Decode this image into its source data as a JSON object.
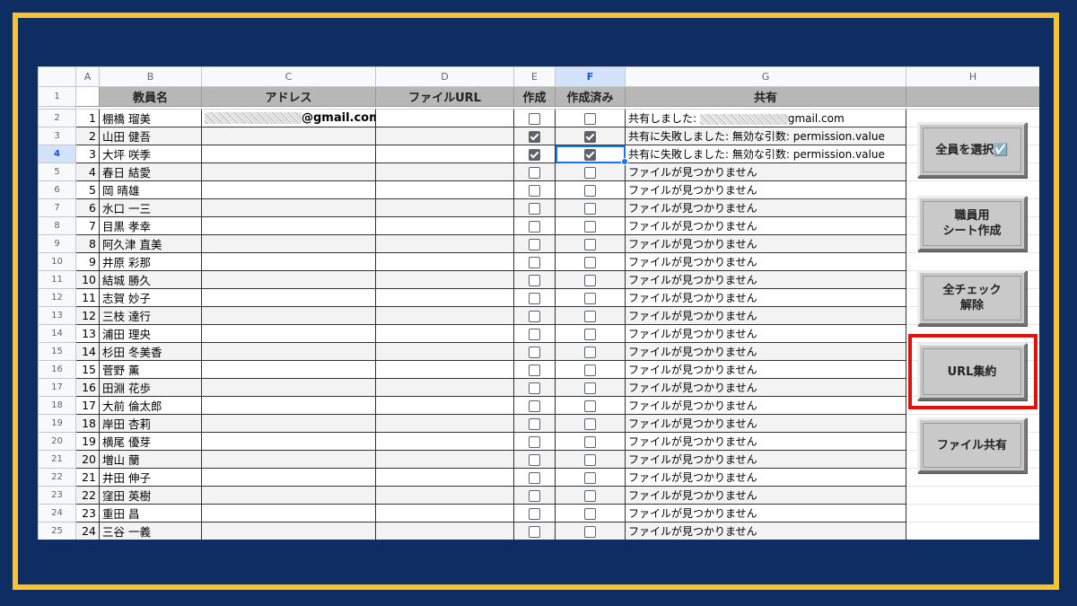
{
  "columns": [
    "",
    "A",
    "B",
    "C",
    "D",
    "E",
    "F",
    "G",
    "H"
  ],
  "selected_column": "F",
  "selected_row": "4",
  "header_row": {
    "row_num": "1",
    "name": "教員名",
    "address": "アドレス",
    "file_url": "ファイルURL",
    "created": "作成",
    "created_done": "作成済み",
    "share": "共有"
  },
  "rows": [
    {
      "rn": "2",
      "num": "1",
      "name": "棚橋 瑠美",
      "address": "@gmail.com",
      "url": "",
      "created": false,
      "done": false,
      "share": "共有しました: ",
      "share_email": "gmail.com"
    },
    {
      "rn": "3",
      "num": "2",
      "name": "山田 健吾",
      "address": "",
      "url": "",
      "created": true,
      "done": true,
      "share": "共有に失敗しました: 無効な引数: permission.value"
    },
    {
      "rn": "4",
      "num": "3",
      "name": "大坪 咲季",
      "address": "",
      "url": "",
      "created": true,
      "done": true,
      "share": "共有に失敗しました: 無効な引数: permission.value"
    },
    {
      "rn": "5",
      "num": "4",
      "name": "春日 結愛",
      "address": "",
      "url": "",
      "created": false,
      "done": false,
      "share": "ファイルが見つかりません"
    },
    {
      "rn": "6",
      "num": "5",
      "name": "岡 晴雄",
      "address": "",
      "url": "",
      "created": false,
      "done": false,
      "share": "ファイルが見つかりません"
    },
    {
      "rn": "7",
      "num": "6",
      "name": "水口 一三",
      "address": "",
      "url": "",
      "created": false,
      "done": false,
      "share": "ファイルが見つかりません"
    },
    {
      "rn": "8",
      "num": "7",
      "name": "目黒 孝幸",
      "address": "",
      "url": "",
      "created": false,
      "done": false,
      "share": "ファイルが見つかりません"
    },
    {
      "rn": "9",
      "num": "8",
      "name": "阿久津 直美",
      "address": "",
      "url": "",
      "created": false,
      "done": false,
      "share": "ファイルが見つかりません"
    },
    {
      "rn": "10",
      "num": "9",
      "name": "井原 彩那",
      "address": "",
      "url": "",
      "created": false,
      "done": false,
      "share": "ファイルが見つかりません"
    },
    {
      "rn": "11",
      "num": "10",
      "name": "結城 勝久",
      "address": "",
      "url": "",
      "created": false,
      "done": false,
      "share": "ファイルが見つかりません"
    },
    {
      "rn": "12",
      "num": "11",
      "name": "志賀 妙子",
      "address": "",
      "url": "",
      "created": false,
      "done": false,
      "share": "ファイルが見つかりません"
    },
    {
      "rn": "13",
      "num": "12",
      "name": "三枝 達行",
      "address": "",
      "url": "",
      "created": false,
      "done": false,
      "share": "ファイルが見つかりません"
    },
    {
      "rn": "14",
      "num": "13",
      "name": "浦田 理央",
      "address": "",
      "url": "",
      "created": false,
      "done": false,
      "share": "ファイルが見つかりません"
    },
    {
      "rn": "15",
      "num": "14",
      "name": "杉田 冬美香",
      "address": "",
      "url": "",
      "created": false,
      "done": false,
      "share": "ファイルが見つかりません"
    },
    {
      "rn": "16",
      "num": "15",
      "name": "菅野 薫",
      "address": "",
      "url": "",
      "created": false,
      "done": false,
      "share": "ファイルが見つかりません"
    },
    {
      "rn": "17",
      "num": "16",
      "name": "田淵 花歩",
      "address": "",
      "url": "",
      "created": false,
      "done": false,
      "share": "ファイルが見つかりません"
    },
    {
      "rn": "18",
      "num": "17",
      "name": "大前 倫太郎",
      "address": "",
      "url": "",
      "created": false,
      "done": false,
      "share": "ファイルが見つかりません"
    },
    {
      "rn": "19",
      "num": "18",
      "name": "岸田 杏莉",
      "address": "",
      "url": "",
      "created": false,
      "done": false,
      "share": "ファイルが見つかりません"
    },
    {
      "rn": "20",
      "num": "19",
      "name": "横尾 優芽",
      "address": "",
      "url": "",
      "created": false,
      "done": false,
      "share": "ファイルが見つかりません"
    },
    {
      "rn": "21",
      "num": "20",
      "name": "増山 蘭",
      "address": "",
      "url": "",
      "created": false,
      "done": false,
      "share": "ファイルが見つかりません"
    },
    {
      "rn": "22",
      "num": "21",
      "name": "井田 伸子",
      "address": "",
      "url": "",
      "created": false,
      "done": false,
      "share": "ファイルが見つかりません"
    },
    {
      "rn": "23",
      "num": "22",
      "name": "窪田 英樹",
      "address": "",
      "url": "",
      "created": false,
      "done": false,
      "share": "ファイルが見つかりません"
    },
    {
      "rn": "24",
      "num": "23",
      "name": "重田 昌",
      "address": "",
      "url": "",
      "created": false,
      "done": false,
      "share": "ファイルが見つかりません"
    },
    {
      "rn": "25",
      "num": "24",
      "name": "三谷 一義",
      "address": "",
      "url": "",
      "created": false,
      "done": false,
      "share": "ファイルが見つかりません"
    }
  ],
  "buttons": {
    "select_all": "全員を選択☑️",
    "create_sheets": "職員用\nシート作成",
    "uncheck_all": "全チェック\n解除",
    "collect_urls": "URL集約",
    "share_files": "ファイル共有"
  },
  "colors": {
    "background": "#0e2d63",
    "frame": "#f6c336",
    "highlight": "#e0120f",
    "header_fill": "#b7b7b7",
    "selection": "#1a73e8"
  }
}
